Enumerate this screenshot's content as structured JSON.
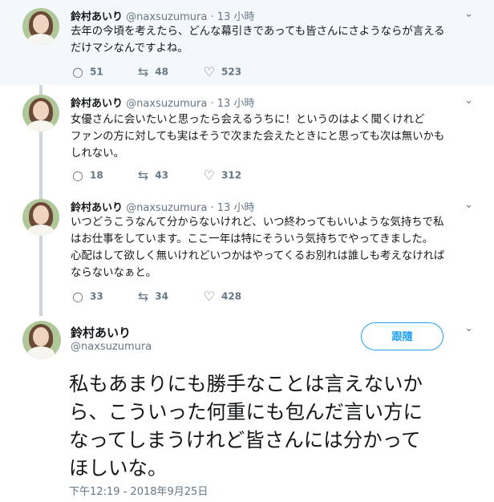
{
  "tweets": [
    {
      "name": "鈴村あいり",
      "handle": "@naxsuzumura",
      "time": "· 13 小時",
      "lines": [
        "去年の今頃を考えたら、どんな幕引きであっても皆さんにさようならが言える",
        "だけマシなんですよね。"
      ],
      "replies": "51",
      "retweets": "48",
      "likes": "523"
    },
    {
      "name": "鈴村あいり",
      "handle": "@naxsuzumura",
      "time": "· 13 小時",
      "lines": [
        "女優さんに会いたいと思ったら会えるうちに！というのはよく聞くけれど",
        "ファンの方に対しても実はそうで次また会えたときにと思っても次は無いかも",
        "しれない。"
      ],
      "replies": "18",
      "retweets": "43",
      "likes": "312"
    },
    {
      "name": "鈴村あいり",
      "handle": "@naxsuzumura",
      "time": "· 13 小時",
      "lines": [
        "いつどうこうなんて分からないけれど、いつ終わってもいいような気持ちで私",
        "はお仕事をしています。ここ一年は特にそういう気持ちでやってきました。",
        "心配はして欲しく無いけれどいつかはやってくるお別れは誰しも考えなければ",
        "ならないなぁと。"
      ],
      "replies": "33",
      "retweets": "34",
      "likes": "428"
    }
  ],
  "main_tweet": {
    "name": "鈴村あいり",
    "handle": "@naxsuzumura",
    "follow_label": "跟隨",
    "lines": [
      "私もあまりにも勝手なことは言えないか",
      "ら、こういった何重にも包んだ言い方に",
      "なってしまうけれど皆さんには分かって",
      "ほしいな。"
    ],
    "timestamp": "下午12:19 - 2018年9月25日"
  },
  "icons": {
    "reply": "reply-icon",
    "retweet": "retweet-icon",
    "like": "heart-icon",
    "more": "chevron-down-icon"
  }
}
